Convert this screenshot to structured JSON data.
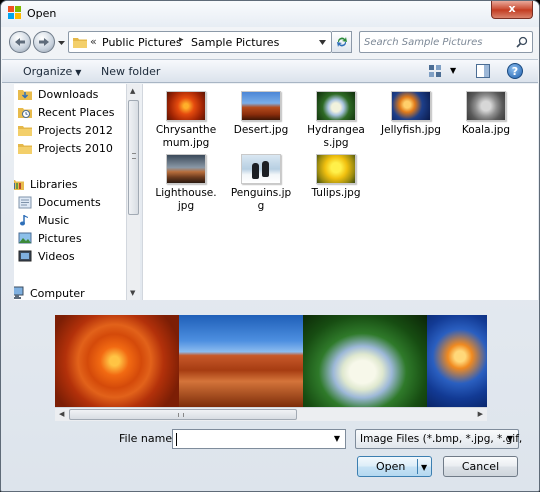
{
  "window": {
    "title": "Open",
    "close_symbol": "x"
  },
  "address": {
    "chevrons": "«",
    "crumbs": [
      "Public Pictures",
      "Sample Pictures"
    ],
    "separator": "▸"
  },
  "search": {
    "placeholder": "Search Sample Pictures"
  },
  "toolbar": {
    "organize_label": "Organize",
    "new_folder_label": "New folder",
    "help_symbol": "?"
  },
  "navpane": {
    "items": [
      {
        "label": "Downloads",
        "icon": "downloads-folder-icon"
      },
      {
        "label": "Recent Places",
        "icon": "recent-places-icon"
      },
      {
        "label": "Projects 2012",
        "icon": "folder-icon"
      },
      {
        "label": "Projects 2010",
        "icon": "folder-icon"
      },
      {
        "label": "Libraries",
        "icon": "libraries-icon"
      },
      {
        "label": "Documents",
        "icon": "documents-icon"
      },
      {
        "label": "Music",
        "icon": "music-icon"
      },
      {
        "label": "Pictures",
        "icon": "pictures-icon"
      },
      {
        "label": "Videos",
        "icon": "videos-icon"
      },
      {
        "label": "Computer",
        "icon": "computer-icon"
      }
    ]
  },
  "files": [
    {
      "name": "Chrysanthe\nmum.jpg"
    },
    {
      "name": "Desert.jpg"
    },
    {
      "name": "Hydrangea\ns.jpg"
    },
    {
      "name": "Jellyfish.jpg"
    },
    {
      "name": "Koala.jpg"
    },
    {
      "name": "Lighthouse.\njpg"
    },
    {
      "name": "Penguins.jp\ng"
    },
    {
      "name": "Tulips.jpg"
    }
  ],
  "bottom": {
    "filename_label": "File name:",
    "filename_value": "",
    "filter_value": "Image Files (*.bmp, *.jpg, *.gif,",
    "open_label": "Open",
    "cancel_label": "Cancel"
  },
  "colors": {
    "accent": "#3c7fb1",
    "close_button": "#c9492f"
  }
}
